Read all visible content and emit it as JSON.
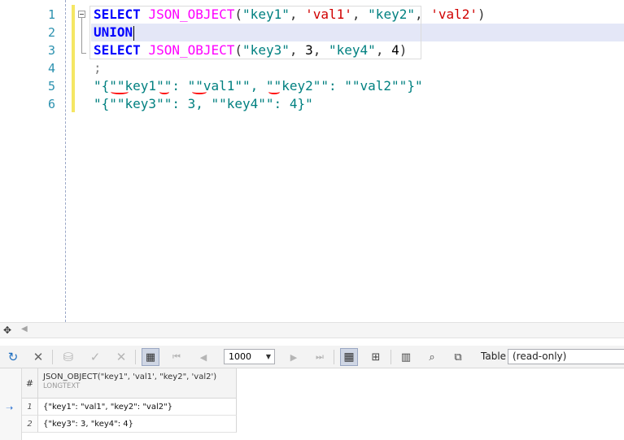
{
  "editor": {
    "line_numbers": [
      "1",
      "2",
      "3",
      "4",
      "5",
      "6"
    ],
    "line1": {
      "kw": "SELECT",
      "fn": "JSON_OBJECT",
      "p_open": "(",
      "s1": "\"key1\"",
      "c1": ", ",
      "s2": "'val1'",
      "c2": ", ",
      "s3": "\"key2\"",
      "c3": ", ",
      "s4": "'val2'",
      "p_close": ")"
    },
    "line2": {
      "kw": "UNION"
    },
    "line3": {
      "kw": "SELECT",
      "fn": "JSON_OBJECT",
      "p_open": "(",
      "s1": "\"key3\"",
      "c1": ", ",
      "n1": "3",
      "c2": ", ",
      "s2": "\"key4\"",
      "c3": ", ",
      "n2": "4",
      "p_close": ")"
    },
    "line4": ";",
    "line5": "\"{\"\"key1\"\": \"\"val1\"\", \"\"key2\"\": \"\"val2\"\"}\"",
    "line6": "\"{\"\"key3\"\": 3, \"\"key4\"\": 4}\""
  },
  "toolbar": {
    "limit_value": "1000",
    "table_label": "Table",
    "table_mode": "(read-only)"
  },
  "grid": {
    "num_header": "#",
    "column_name": "JSON_OBJECT(\"key1\", 'val1', \"key2\", 'val2')",
    "column_type": "LONGTEXT",
    "rows": [
      {
        "num": "1",
        "value": "{\"key1\": \"val1\", \"key2\": \"val2\"}"
      },
      {
        "num": "2",
        "value": "{\"key3\": 3, \"key4\": 4}"
      }
    ]
  }
}
